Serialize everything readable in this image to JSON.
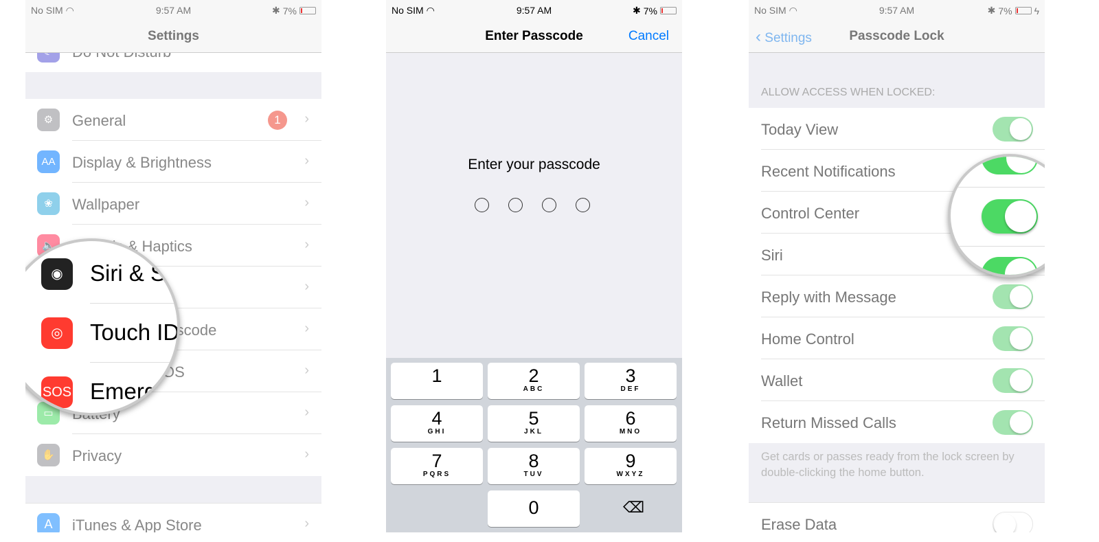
{
  "status": {
    "carrier": "No SIM",
    "time": "9:57 AM",
    "battery": "7%"
  },
  "settings": {
    "title": "Settings",
    "top_partial": "Do Not Disturb",
    "items": [
      {
        "label": "General",
        "icon": "gear-icon",
        "color": "#8e8e93",
        "badge": "1"
      },
      {
        "label": "Display & Brightness",
        "icon": "display-icon",
        "color": "#007aff"
      },
      {
        "label": "Wallpaper",
        "icon": "wallpaper-icon",
        "color": "#34aadc"
      },
      {
        "label": "Sounds & Haptics",
        "icon": "speaker-icon",
        "color": "#ff2d55"
      },
      {
        "label": "Siri & Search",
        "icon": "siri-icon",
        "color": "#222"
      },
      {
        "label": "Touch ID & Passcode",
        "icon": "fingerprint-icon",
        "color": "#ff3b30"
      },
      {
        "label": "Emergency SOS",
        "icon": "sos-icon",
        "color": "#ff3b30"
      },
      {
        "label": "Battery",
        "icon": "battery-icon",
        "color": "#4cd964"
      },
      {
        "label": "Privacy",
        "icon": "hand-icon",
        "color": "#8e8e93"
      }
    ],
    "after_gap": {
      "label": "iTunes & App Store",
      "icon": "app-store-icon",
      "color": "#1a8cff"
    }
  },
  "passcode": {
    "title": "Enter Passcode",
    "cancel": "Cancel",
    "prompt": "Enter your passcode",
    "digits_entered": 0,
    "digits_total": 4,
    "keys": [
      [
        "1",
        ""
      ],
      [
        "2",
        "ABC"
      ],
      [
        "3",
        "DEF"
      ],
      [
        "4",
        "GHI"
      ],
      [
        "5",
        "JKL"
      ],
      [
        "6",
        "MNO"
      ],
      [
        "7",
        "PQRS"
      ],
      [
        "8",
        "TUV"
      ],
      [
        "9",
        "WXYZ"
      ],
      [
        "0",
        ""
      ]
    ]
  },
  "lock": {
    "back": "Settings",
    "title": "Passcode Lock",
    "section_header": "ALLOW ACCESS WHEN LOCKED:",
    "items": [
      {
        "label": "Today View",
        "on": true
      },
      {
        "label": "Recent Notifications",
        "on": true
      },
      {
        "label": "Control Center",
        "on": true
      },
      {
        "label": "Siri",
        "on": true
      },
      {
        "label": "Reply with Message",
        "on": true
      },
      {
        "label": "Home Control",
        "on": true
      },
      {
        "label": "Wallet",
        "on": true
      },
      {
        "label": "Return Missed Calls",
        "on": true
      }
    ],
    "footer": "Get cards or passes ready from the lock screen by double-clicking the home button.",
    "erase": {
      "label": "Erase Data",
      "on": false
    },
    "accent": "#007aff",
    "toggle_on": "#4cd964"
  }
}
